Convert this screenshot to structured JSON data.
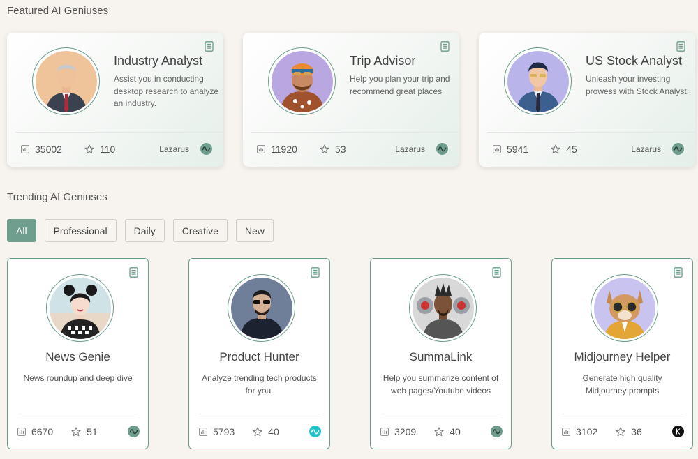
{
  "featured": {
    "title": "Featured AI Geniuses",
    "cards": [
      {
        "name": "Industry Analyst",
        "desc": "Assist you in conducting desktop research to analyze an industry.",
        "uses": "35002",
        "stars": "110",
        "author": "Lazarus",
        "avatar": "businessman-avatar",
        "avatar_bg": "#f0c49a"
      },
      {
        "name": "Trip Advisor",
        "desc": "Help you plan your trip and recommend great places",
        "uses": "11920",
        "stars": "53",
        "author": "Lazarus",
        "avatar": "traveler-avatar",
        "avatar_bg": "#b8a7e0"
      },
      {
        "name": "US Stock Analyst",
        "desc": "Unleash your investing prowess with Stock Analyst.",
        "uses": "5941",
        "stars": "45",
        "author": "Lazarus",
        "avatar": "stock-analyst-avatar",
        "avatar_bg": "#b9b4ea"
      }
    ]
  },
  "trending": {
    "title": "Trending AI Geniuses",
    "filters": [
      "All",
      "Professional",
      "Daily",
      "Creative",
      "New"
    ],
    "active_filter": "All",
    "cards": [
      {
        "name": "News Genie",
        "desc": "News roundup and deep dive",
        "uses": "6670",
        "stars": "51",
        "avatar": "news-woman-avatar",
        "avatar_bg": "#cfe3e6",
        "badge_color": "#6f9e8e"
      },
      {
        "name": "Product Hunter",
        "desc": "Analyze trending tech products for you.",
        "uses": "5793",
        "stars": "40",
        "avatar": "product-hunter-avatar",
        "avatar_bg": "#6f7f99",
        "badge_color": "#23c4c9"
      },
      {
        "name": "SummaLink",
        "desc": "Help you summarize content of web pages/Youtube videos",
        "uses": "3209",
        "stars": "40",
        "avatar": "cyborg-avatar",
        "avatar_bg": "#d8d8d8",
        "badge_color": "#6f9e8e"
      },
      {
        "name": "Midjourney Helper",
        "desc": "Generate high quality Midjourney prompts",
        "uses": "3102",
        "stars": "36",
        "avatar": "cat-sunglasses-avatar",
        "avatar_bg": "#c9c4ef",
        "badge_color": "#111111"
      }
    ]
  },
  "colors": {
    "accent": "#6f9e8e",
    "background": "#f7f4ef"
  },
  "icons": {
    "doc": "document-icon",
    "chart": "bar-chart-icon",
    "star": "star-icon"
  }
}
